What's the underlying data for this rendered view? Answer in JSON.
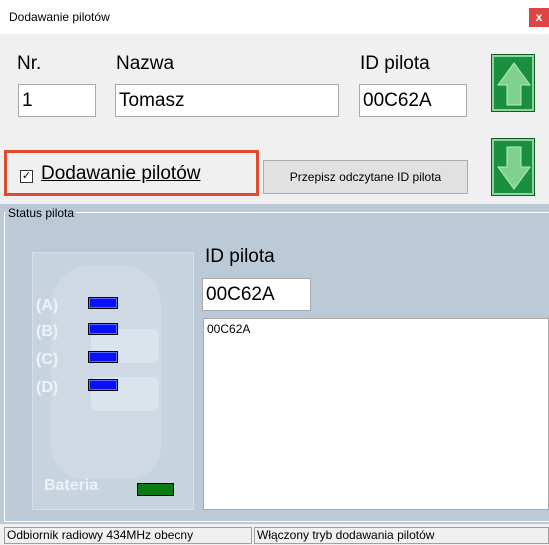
{
  "window": {
    "title": "Dodawanie pilotów",
    "close_label": "x"
  },
  "header": {
    "nr_label": "Nr.",
    "nazwa_label": "Nazwa",
    "id_label": "ID pilota",
    "nr_value": "1",
    "nazwa_value": "Tomasz",
    "id_value": "00C62A"
  },
  "checkbox": {
    "checked": true,
    "mark": "✓",
    "label": "Dodawanie pilotów"
  },
  "copy_button": {
    "label": "Przepisz odczytane ID pilota"
  },
  "arrows": {
    "up_icon": "arrow-up-icon",
    "down_icon": "arrow-down-icon",
    "color": "#1a8f3d"
  },
  "status": {
    "group_title": "Status pilota",
    "keys": [
      "(A)",
      "(B)",
      "(C)",
      "(D)"
    ],
    "battery_label": "Bateria",
    "led_color": "#0a12f5",
    "battery_color": "#0b7a12",
    "id_label": "ID pilota",
    "id_value": "00C62A",
    "list_items": [
      "00C62A"
    ]
  },
  "statusbar": {
    "left": "Odbiornik radiowy 434MHz obecny",
    "right": "Włączony tryb dodawania pilotów"
  }
}
